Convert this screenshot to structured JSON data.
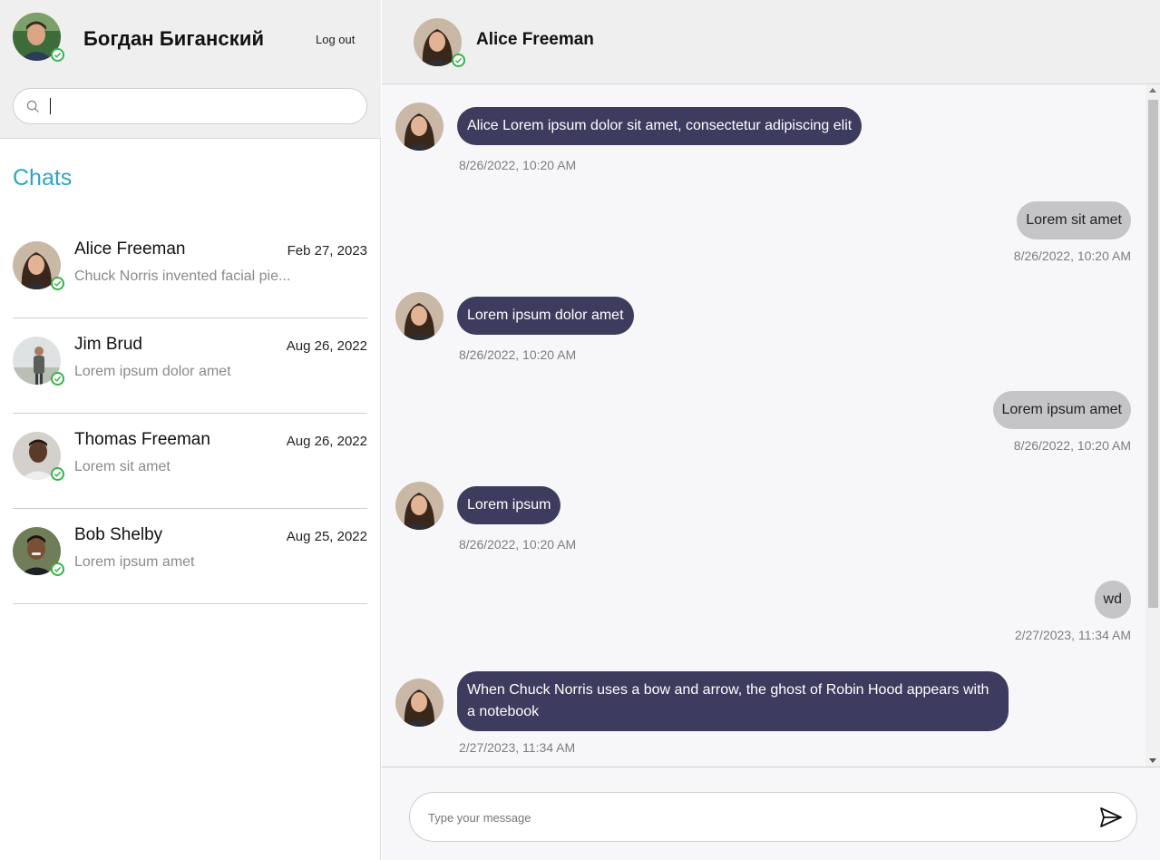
{
  "user": {
    "name": "Богдан Биганский",
    "logout_label": "Log out"
  },
  "search": {
    "placeholder": "",
    "value": ""
  },
  "sidebar": {
    "title": "Chats",
    "chats": [
      {
        "name": "Alice Freeman",
        "date": "Feb 27, 2023",
        "last_message": "Chuck Norris invented facial pie...",
        "online": true
      },
      {
        "name": "Jim Brud",
        "date": "Aug 26, 2022",
        "last_message": "Lorem ipsum dolor amet",
        "online": true
      },
      {
        "name": "Thomas Freeman",
        "date": "Aug 26, 2022",
        "last_message": "Lorem sit amet",
        "online": true
      },
      {
        "name": "Bob Shelby",
        "date": "Aug 25, 2022",
        "last_message": "Lorem ipsum amet",
        "online": true
      }
    ]
  },
  "conversation": {
    "contact_name": "Alice Freeman",
    "messages": [
      {
        "direction": "in",
        "text": "Alice Lorem ipsum dolor sit amet, consectetur adipiscing elit",
        "time": "8/26/2022, 10:20 AM"
      },
      {
        "direction": "out",
        "text": "Lorem sit amet",
        "time": "8/26/2022, 10:20 AM"
      },
      {
        "direction": "in",
        "text": "Lorem ipsum dolor amet",
        "time": "8/26/2022, 10:20 AM"
      },
      {
        "direction": "out",
        "text": "Lorem ipsum amet",
        "time": "8/26/2022, 10:20 AM"
      },
      {
        "direction": "in",
        "text": "Lorem ipsum",
        "time": "8/26/2022, 10:20 AM"
      },
      {
        "direction": "out",
        "text": "wd",
        "time": "2/27/2023, 11:34 AM"
      },
      {
        "direction": "in",
        "text": "When Chuck Norris uses a bow and arrow, the ghost of Robin Hood appears with a notebook",
        "time": "2/27/2023, 11:34 AM"
      }
    ]
  },
  "composer": {
    "placeholder": "Type your message",
    "value": ""
  },
  "icons": {
    "search": "search-icon",
    "send": "send-icon",
    "online": "online-check-icon"
  },
  "colors": {
    "accent": "#2aa6c4",
    "incoming_bubble": "#3d3b5e",
    "outgoing_bubble": "#c5c4c6",
    "online": "#35b34a"
  }
}
